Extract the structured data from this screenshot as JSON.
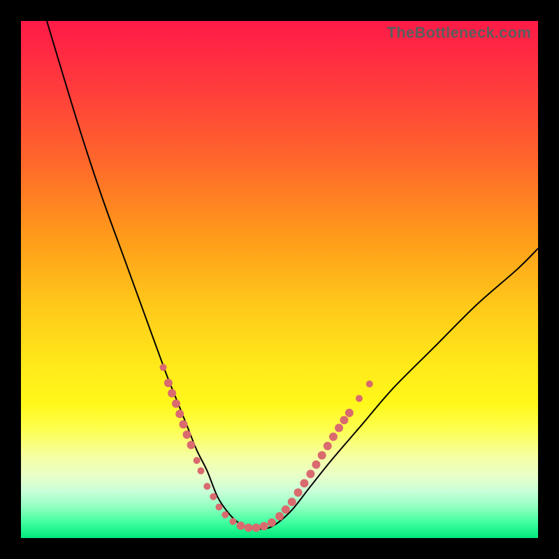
{
  "attribution": "TheBottleneck.com",
  "colors": {
    "background": "#000000",
    "marker_fill": "#d96a6e",
    "curve_stroke": "#000000"
  },
  "chart_data": {
    "type": "line",
    "title": "",
    "xlabel": "",
    "ylabel": "",
    "xlim": [
      0,
      100
    ],
    "ylim": [
      0,
      100
    ],
    "series": [
      {
        "name": "bottleneck-curve",
        "x": [
          5,
          8,
          12,
          16,
          20,
          24,
          28,
          30,
          32,
          34,
          36,
          38,
          40,
          42,
          44,
          48,
          52,
          56,
          60,
          66,
          72,
          80,
          88,
          96,
          100
        ],
        "y": [
          100,
          90,
          77,
          65,
          54,
          43,
          32,
          27,
          22,
          17,
          13,
          8,
          5,
          3,
          2,
          2,
          5,
          10,
          15,
          22,
          29,
          37,
          45,
          52,
          56
        ]
      }
    ],
    "markers": [
      {
        "x": 27.5,
        "y": 33,
        "r": 5
      },
      {
        "x": 28.5,
        "y": 30,
        "r": 6
      },
      {
        "x": 29.2,
        "y": 28,
        "r": 6
      },
      {
        "x": 30.0,
        "y": 26,
        "r": 6
      },
      {
        "x": 30.7,
        "y": 24,
        "r": 6
      },
      {
        "x": 31.4,
        "y": 22,
        "r": 6
      },
      {
        "x": 32.1,
        "y": 20,
        "r": 6
      },
      {
        "x": 32.9,
        "y": 18,
        "r": 6
      },
      {
        "x": 34.0,
        "y": 15,
        "r": 5
      },
      {
        "x": 34.8,
        "y": 13,
        "r": 5
      },
      {
        "x": 36.0,
        "y": 10,
        "r": 5
      },
      {
        "x": 37.2,
        "y": 8,
        "r": 5
      },
      {
        "x": 38.3,
        "y": 6,
        "r": 5
      },
      {
        "x": 39.5,
        "y": 4.5,
        "r": 5
      },
      {
        "x": 41.0,
        "y": 3.2,
        "r": 5
      },
      {
        "x": 42.5,
        "y": 2.4,
        "r": 6
      },
      {
        "x": 44.0,
        "y": 2.0,
        "r": 6
      },
      {
        "x": 45.5,
        "y": 2.0,
        "r": 6
      },
      {
        "x": 47.0,
        "y": 2.3,
        "r": 6
      },
      {
        "x": 48.5,
        "y": 3.0,
        "r": 6
      },
      {
        "x": 50.0,
        "y": 4.2,
        "r": 6
      },
      {
        "x": 51.2,
        "y": 5.5,
        "r": 6
      },
      {
        "x": 52.4,
        "y": 7.0,
        "r": 6
      },
      {
        "x": 53.6,
        "y": 8.8,
        "r": 6
      },
      {
        "x": 54.8,
        "y": 10.6,
        "r": 6
      },
      {
        "x": 56.0,
        "y": 12.4,
        "r": 6
      },
      {
        "x": 57.1,
        "y": 14.2,
        "r": 6
      },
      {
        "x": 58.2,
        "y": 16.0,
        "r": 6
      },
      {
        "x": 59.3,
        "y": 17.8,
        "r": 6
      },
      {
        "x": 60.4,
        "y": 19.6,
        "r": 6
      },
      {
        "x": 61.5,
        "y": 21.3,
        "r": 6
      },
      {
        "x": 62.5,
        "y": 22.8,
        "r": 6
      },
      {
        "x": 63.5,
        "y": 24.2,
        "r": 6
      },
      {
        "x": 65.4,
        "y": 27.0,
        "r": 5
      },
      {
        "x": 67.4,
        "y": 29.8,
        "r": 5
      }
    ],
    "gradient_stops": [
      {
        "offset": 0,
        "color": "#ff1a48"
      },
      {
        "offset": 13,
        "color": "#ff3c3c"
      },
      {
        "offset": 28,
        "color": "#ff6a2a"
      },
      {
        "offset": 42,
        "color": "#ff9c1a"
      },
      {
        "offset": 55,
        "color": "#ffc81a"
      },
      {
        "offset": 66,
        "color": "#ffe81a"
      },
      {
        "offset": 74,
        "color": "#fff81a"
      },
      {
        "offset": 79,
        "color": "#fdff50"
      },
      {
        "offset": 84,
        "color": "#f6ffa0"
      },
      {
        "offset": 88,
        "color": "#e8ffc8"
      },
      {
        "offset": 91,
        "color": "#c8ffd8"
      },
      {
        "offset": 94,
        "color": "#90ffc0"
      },
      {
        "offset": 97,
        "color": "#40ffa0"
      },
      {
        "offset": 100,
        "color": "#00e87c"
      }
    ]
  }
}
